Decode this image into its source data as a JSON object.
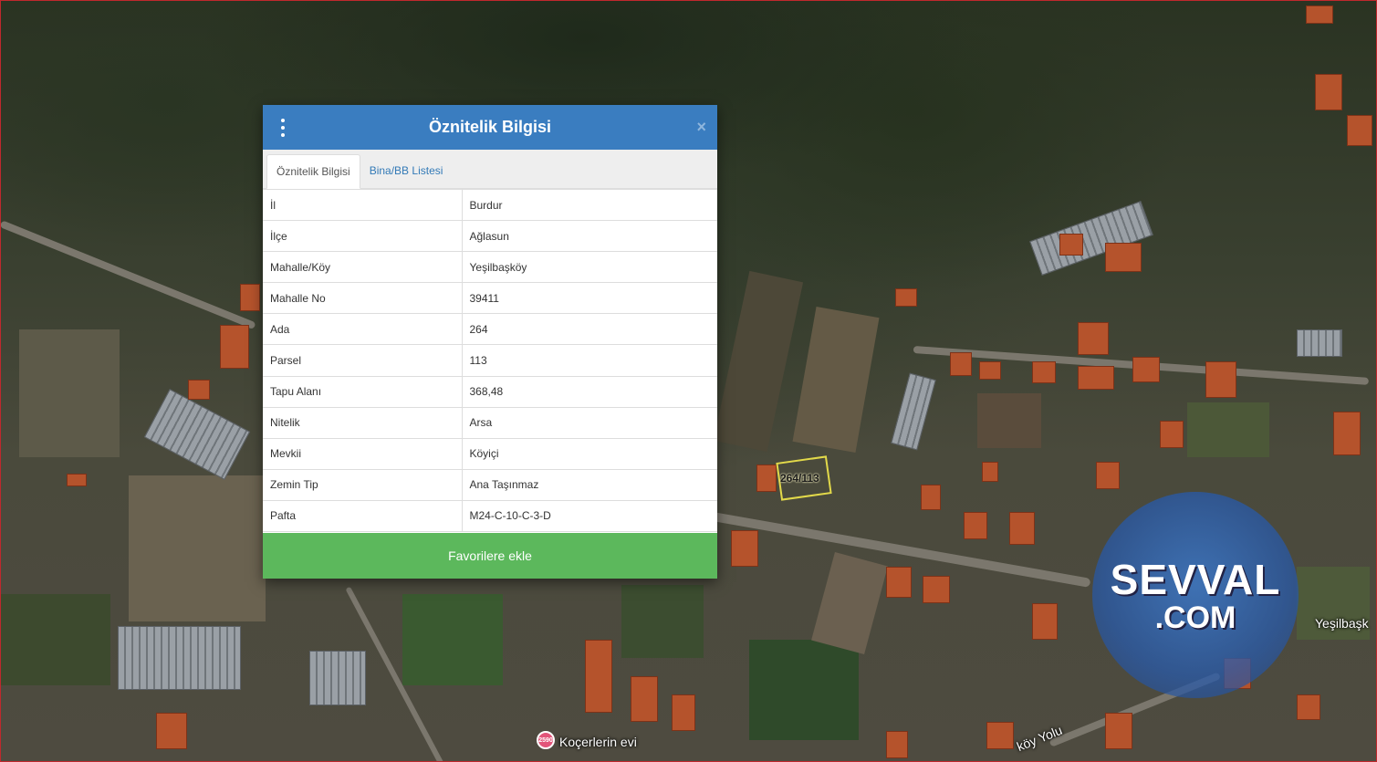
{
  "dialog": {
    "title": "Öznitelik Bilgisi",
    "close_symbol": "×",
    "tabs": [
      {
        "label": "Öznitelik Bilgisi",
        "active": true
      },
      {
        "label": "Bina/BB Listesi",
        "active": false
      }
    ],
    "rows": [
      {
        "key": "İl",
        "value": "Burdur"
      },
      {
        "key": "İlçe",
        "value": "Ağlasun"
      },
      {
        "key": "Mahalle/Köy",
        "value": "Yeşilbaşköy"
      },
      {
        "key": "Mahalle No",
        "value": "39411"
      },
      {
        "key": "Ada",
        "value": "264"
      },
      {
        "key": "Parsel",
        "value": "113"
      },
      {
        "key": "Tapu Alanı",
        "value": "368,48"
      },
      {
        "key": "Nitelik",
        "value": "Arsa"
      },
      {
        "key": "Mevkii",
        "value": "Köyiçi"
      },
      {
        "key": "Zemin Tip",
        "value": "Ana Taşınmaz"
      },
      {
        "key": "Pafta",
        "value": "M24-C-10-C-3-D"
      }
    ],
    "favorite_button": "Favorilere ekle"
  },
  "map": {
    "parcel_label": "264/113",
    "place_label": "Yeşilbaşk",
    "road_label": "köy Yolu",
    "poi_label": "Koçerlerin evi",
    "poi_icon_text": "2590"
  },
  "watermark": {
    "line1": "SEVVAL",
    "line2": ".COM"
  },
  "colors": {
    "header": "#3a7dc0",
    "favorite_button": "#5cb85c",
    "tab_link": "#337ab7",
    "map_border": "#c0282d",
    "parcel_outline": "#e2d94a"
  },
  "icons": {
    "menu": "menu-dots-icon",
    "close": "close-icon",
    "poi": "poi-marker-icon"
  }
}
